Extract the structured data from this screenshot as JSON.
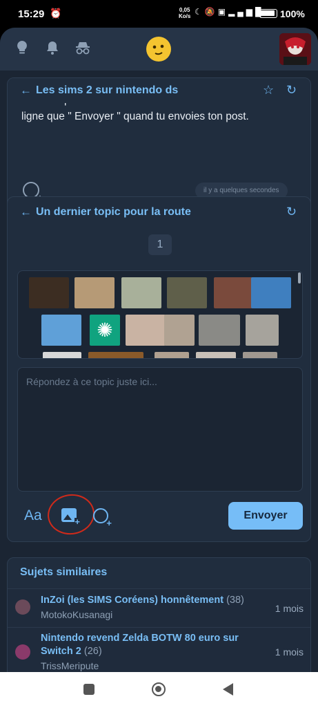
{
  "status_bar": {
    "time": "15:29",
    "network_speed_value": "0,05",
    "network_speed_unit": "Ko/s",
    "battery_percent": "100%"
  },
  "topbar": {
    "icons": [
      "lightbulb-icon",
      "bell-icon",
      "incognito-icon"
    ],
    "logo": "smiley-logo"
  },
  "topic1": {
    "title": "Les sims 2 sur nintendo ds",
    "post_text": "dans les posts. Une nouvelle icône s'affichera sur la même ligne que \" Envoyer \" quand tu envoies ton post.",
    "timestamp": "il y a quelques secondes"
  },
  "topic2": {
    "title": "Un dernier topic pour la route",
    "page_number": "1",
    "reply_placeholder": "Répondez à ce topic juste ici...",
    "format_label": "Aa",
    "send_label": "Envoyer",
    "stickers": [
      {
        "name": "sticker-black-cat",
        "color": "#3c2d22"
      },
      {
        "name": "sticker-cat-lying",
        "color": "#b69a76"
      },
      {
        "name": "sticker-cat-sunglasses",
        "color": "#a8b09a"
      },
      {
        "name": "sticker-cat-dark-eyes",
        "color": "#5f5f4a"
      },
      {
        "name": "sticker-woman-shush",
        "color": "#7a4a3c"
      },
      {
        "name": "sticker-man-glasses-blue",
        "color": "#3f7fbf"
      },
      {
        "name": "sticker-man-smiling-blue",
        "color": "#5fa0d8"
      },
      {
        "name": "sticker-openai-logo",
        "color": "#10a37f"
      },
      {
        "name": "sticker-man-glasses-1",
        "color": "#c9b3a3"
      },
      {
        "name": "sticker-man-glasses-2",
        "color": "#b0a292"
      },
      {
        "name": "sticker-old-man-1",
        "color": "#8a8a86"
      },
      {
        "name": "sticker-old-man-2",
        "color": "#a6a39c"
      }
    ]
  },
  "similar": {
    "title": "Sujets similaires",
    "items": [
      {
        "topic": "InZoi (les SIMS Coréens) honnêtement",
        "count": "(38)",
        "author": "MotokoKusanagi",
        "time": "1 mois",
        "avatar_color": "#6b4a5a"
      },
      {
        "topic": "Nintendo revend Zelda BOTW 80 euro sur Switch 2",
        "count": "(26)",
        "author": "TrissMeripute",
        "time": "1 mois",
        "avatar_color": "#8a3a6a"
      }
    ]
  },
  "colors": {
    "accent": "#79bef5",
    "background": "#1b2533",
    "card": "#202d3e",
    "annotation_circle": "#d02a1a"
  }
}
